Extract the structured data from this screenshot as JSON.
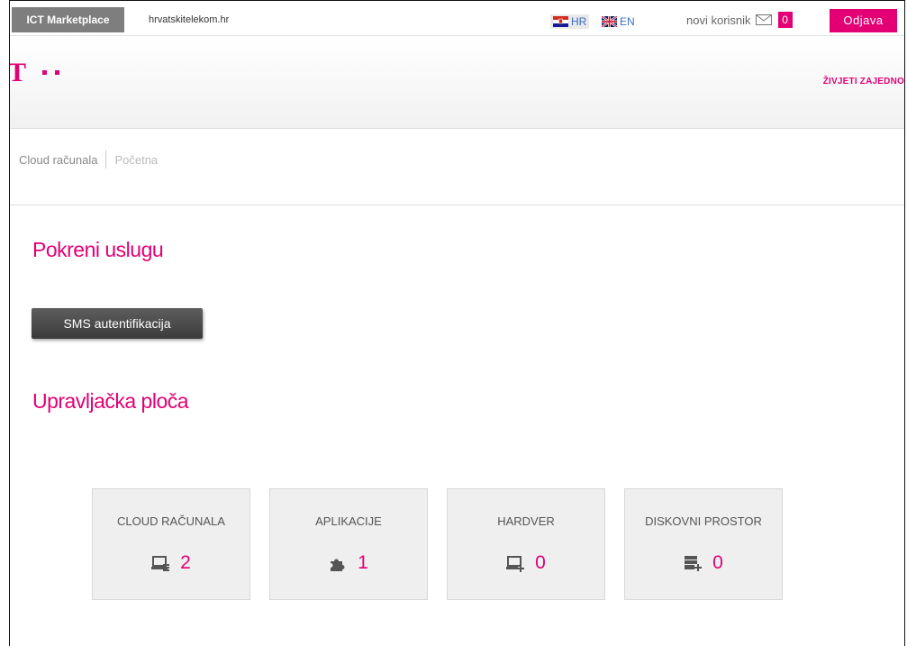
{
  "topbar": {
    "marketplace_label": "ICT Marketplace",
    "site_link": "hrvatskitelekom.hr",
    "lang_hr": "HR",
    "lang_en": "EN",
    "user_label": "novi korisnik",
    "message_count": "0",
    "logout_label": "Odjava"
  },
  "header": {
    "logo_glyph": "T",
    "slogan": "ŽIVJETI ZAJEDNO"
  },
  "breadcrumb": {
    "items": [
      "Cloud računala",
      "Početna"
    ]
  },
  "main": {
    "section1_title": "Pokreni uslugu",
    "sms_button": "SMS autentifikacija",
    "section2_title": "Upravljačka ploča",
    "tiles": [
      {
        "label": "CLOUD RAČUNALA",
        "count": "2",
        "icon": "computer-icon"
      },
      {
        "label": "APLIKACIJE",
        "count": "1",
        "icon": "puzzle-icon"
      },
      {
        "label": "HARDVER",
        "count": "0",
        "icon": "computer-add-icon"
      },
      {
        "label": "DISKOVNI PROSTOR",
        "count": "0",
        "icon": "storage-add-icon"
      }
    ]
  },
  "colors": {
    "brand": "#e20074",
    "button_dark": "#4a4a4a",
    "marketplace_grey": "#7e7e7e"
  }
}
